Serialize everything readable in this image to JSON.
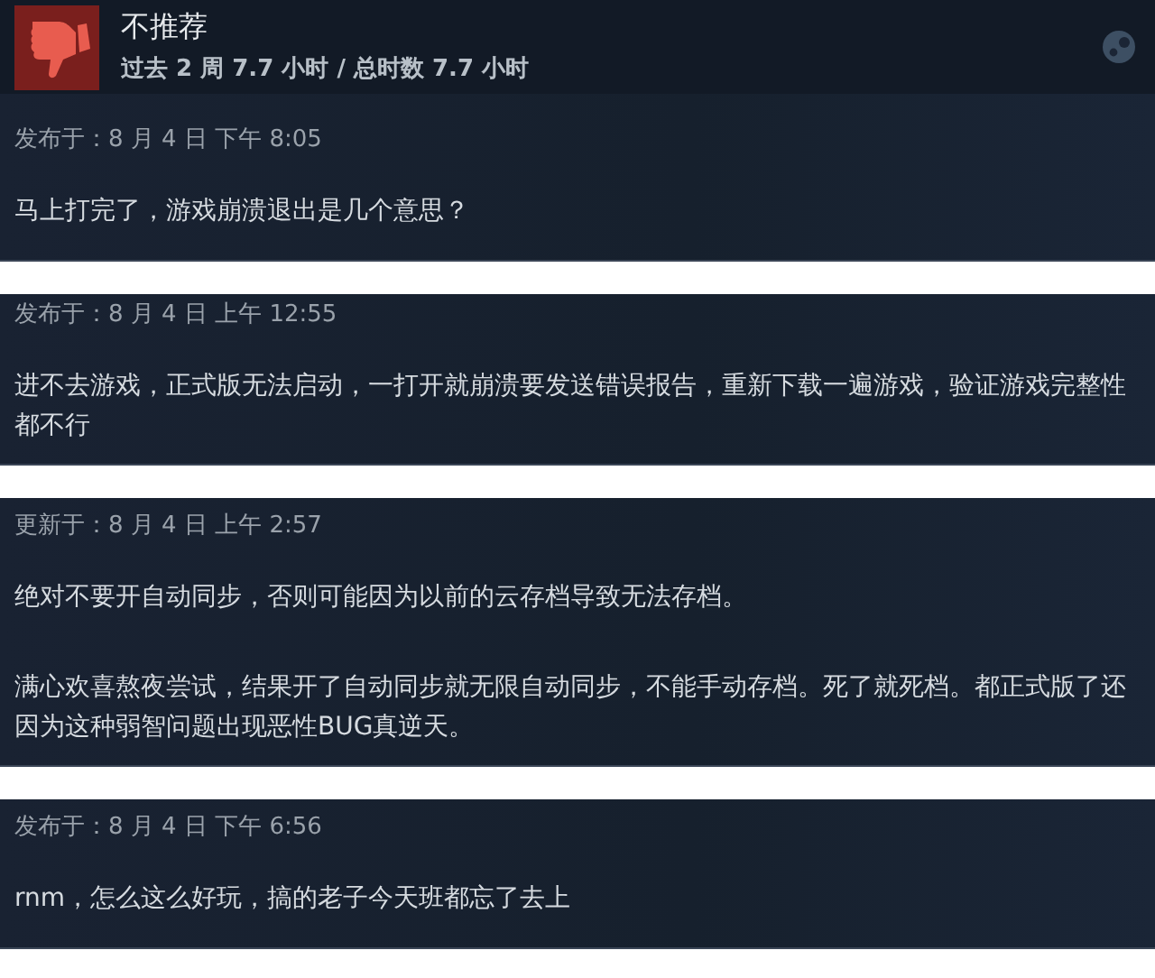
{
  "header": {
    "verdict": "不推荐",
    "playtime": "过去 2 周 7.7 小时 / 总时数 7.7 小时"
  },
  "reviews": [
    {
      "date_line": "发布于：8 月 4 日 下午 8:05",
      "paragraphs": [
        "马上打完了，游戏崩溃退出是几个意思？"
      ]
    },
    {
      "date_line": "发布于：8 月 4 日 上午 12:55",
      "paragraphs": [
        "进不去游戏，正式版无法启动，一打开就崩溃要发送错误报告，重新下载一遍游戏，验证游戏完整性都不行"
      ]
    },
    {
      "date_line": "更新于：8 月 4 日 上午 2:57",
      "paragraphs": [
        "绝对不要开自动同步，否则可能因为以前的云存档导致无法存档。",
        "满心欢喜熬夜尝试，结果开了自动同步就无限自动同步，不能手动存档。死了就死档。都正式版了还因为这种弱智问题出现恶性BUG真逆天。"
      ]
    },
    {
      "date_line": "发布于：8 月 4 日 下午 6:56",
      "paragraphs": [
        "rnm，怎么这么好玩，搞的老子今天班都忘了去上"
      ]
    }
  ]
}
